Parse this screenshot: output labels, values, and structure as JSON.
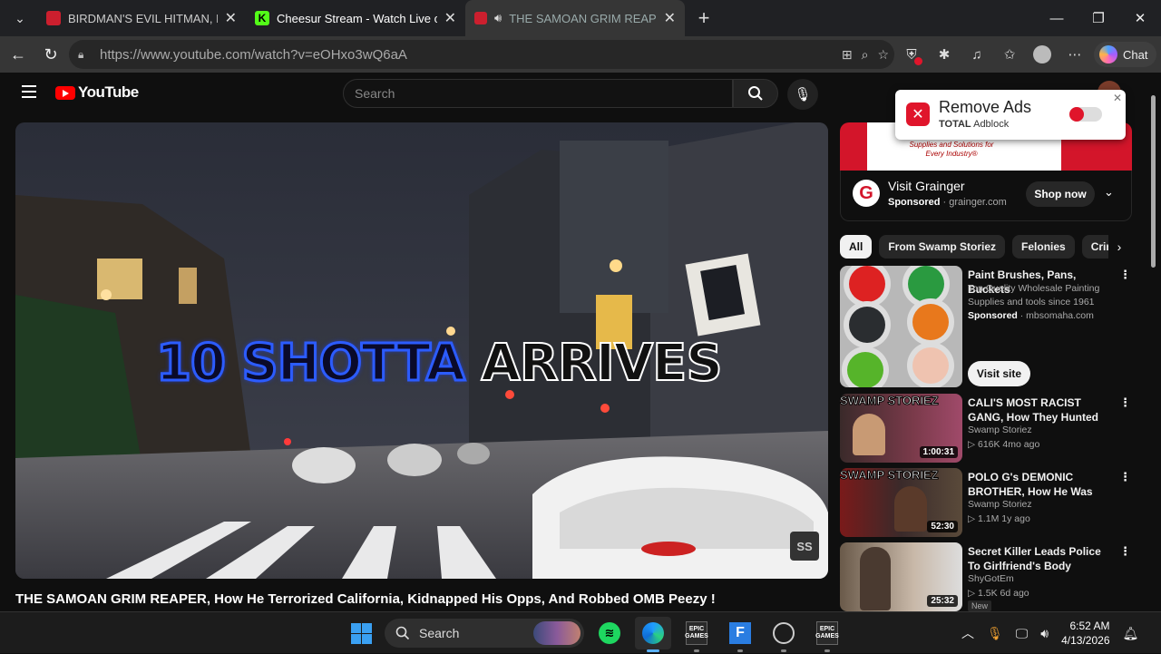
{
  "browser": {
    "tabs": [
      {
        "title": "BIRDMAN'S EVIL HITMAN, How Ha",
        "close": "✕"
      },
      {
        "title": "Cheesur Stream - Watch Live on Ki",
        "close": "✕"
      },
      {
        "title": "THE SAMOAN GRIM REAPER,",
        "close": "✕"
      }
    ],
    "url_host": "https://www.youtube.com",
    "url_path": "/watch?v=eOHxo3wQ6aA",
    "chat_label": "Chat",
    "colors": {
      "tab_youtube": "#cc1f2e",
      "tab_kick": "#53fc18"
    }
  },
  "youtube": {
    "logo_text": "YouTube",
    "search_placeholder": "Search",
    "video": {
      "overlay_part1": "10 SHOTTA ",
      "overlay_part2": "ARRIVES",
      "watermark": "SS",
      "title": "THE SAMOAN GRIM REAPER, How He Terrorized California, Kidnapped His Opps, And Robbed OMB Peezy !"
    },
    "ad": {
      "banner_text": "Supplies and Solutions for Every Industry®",
      "title": "Visit Grainger",
      "sponsored": "Sponsored",
      "domain": "· grainger.com",
      "cta": "Shop now",
      "logo_letter": "G"
    },
    "chips": [
      "All",
      "From Swamp Storiez",
      "Felonies",
      "Crime"
    ],
    "recs": [
      {
        "title": "Paint Brushes, Pans, Buckets",
        "line2": "Top Quality Wholesale Painting",
        "line3": "Supplies and tools since 1961",
        "sponsored": "Sponsored",
        "domain": "· mbsomaha.com",
        "cta": "Visit site"
      },
      {
        "title": "CALI'S MOST RACIST GANG, How They Hunted Black ...",
        "channel": "Swamp Storiez",
        "meta": "▷ 616K   4mo ago",
        "duration": "1:00:31",
        "thumb_text": "SWAMP STORIEZ"
      },
      {
        "title": "POLO G's DEMONIC BROTHER, How He Was SHOT By His Mo...",
        "channel": "Swamp Storiez",
        "meta": "▷ 1.1M   1y ago",
        "duration": "52:30",
        "thumb_text": "SWAMP STORIEZ"
      },
      {
        "title": "Secret Killer Leads Police To Girlfriend's Body",
        "channel": "ShyGotEm",
        "meta": "▷ 1.5K   6d ago",
        "duration": "25:32",
        "badge": "New"
      }
    ]
  },
  "adblock_popup": {
    "title": "Remove Ads",
    "brand_bold": "TOTAL",
    "brand_rest": " Adblock",
    "close": "✕",
    "toggle_on": false
  },
  "taskbar": {
    "search_label": "Search",
    "epic_label": "EPIC GAMES",
    "time": "6:52 AM",
    "date": "4/13/2026"
  }
}
